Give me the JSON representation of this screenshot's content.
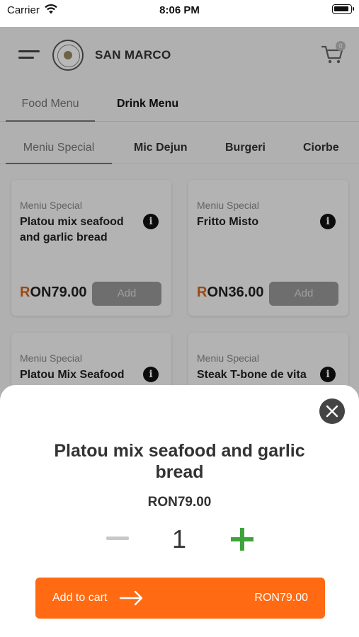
{
  "status_bar": {
    "carrier": "Carrier",
    "time": "8:06 PM"
  },
  "header": {
    "brand": "SAN MARCO",
    "cart_count": "0"
  },
  "menu_tabs": [
    {
      "label": "Food Menu"
    },
    {
      "label": "Drink Menu"
    }
  ],
  "categories": [
    {
      "label": "Meniu Special"
    },
    {
      "label": "Mic Dejun"
    },
    {
      "label": "Burgeri"
    },
    {
      "label": "Ciorbe"
    }
  ],
  "products": [
    {
      "category": "Meniu Special",
      "name": "Platou mix seafood and garlic bread",
      "price_first": "R",
      "price_rest": "ON79.00",
      "add_label": "Add"
    },
    {
      "category": "Meniu Special",
      "name": "Fritto Misto",
      "price_first": "R",
      "price_rest": "ON36.00",
      "add_label": "Add"
    },
    {
      "category": "Meniu Special",
      "name": "Platou Mix Seafood"
    },
    {
      "category": "Meniu Special",
      "name": "Steak T-bone de vita"
    }
  ],
  "sheet": {
    "title": "Platou mix seafood and garlic bread",
    "price": "RON79.00",
    "quantity": "1",
    "add_to_cart_label": "Add to cart",
    "total": "RON79.00"
  },
  "colors": {
    "accent": "#ff6a13",
    "plus": "#3ea33a"
  }
}
